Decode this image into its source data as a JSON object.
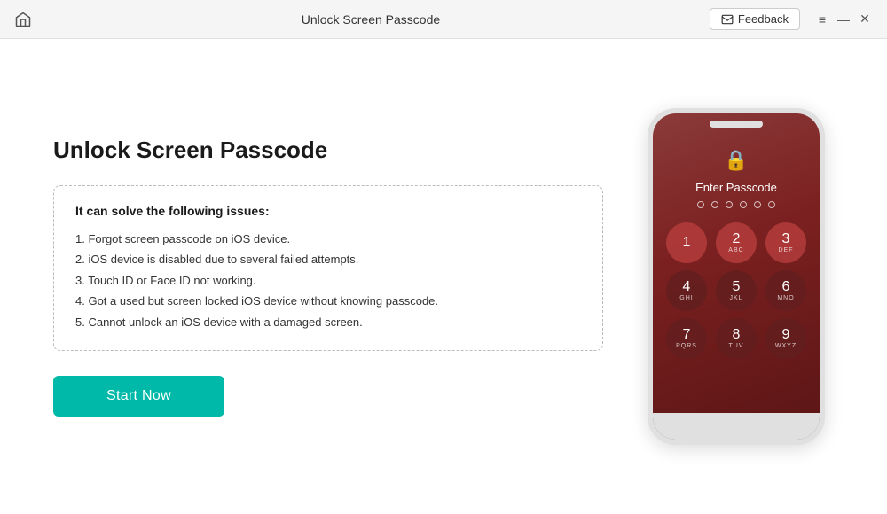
{
  "titlebar": {
    "title": "Unlock Screen Passcode",
    "feedback_label": "Feedback",
    "minimize_icon": "—",
    "close_icon": "✕",
    "menu_icon": "≡"
  },
  "main": {
    "page_title": "Unlock Screen Passcode",
    "issues_heading": "It can solve the following issues:",
    "issues": [
      "1. Forgot screen passcode on iOS device.",
      "2. iOS device is disabled due to several failed attempts.",
      "3. Touch ID or Face ID not working.",
      "4. Got a used but screen locked iOS device without knowing passcode.",
      "5. Cannot unlock an iOS device with a damaged screen."
    ],
    "start_button_label": "Start Now"
  },
  "phone": {
    "enter_passcode_text": "Enter Passcode",
    "numpad": [
      {
        "main": "1",
        "sub": ""
      },
      {
        "main": "2",
        "sub": "ABC"
      },
      {
        "main": "3",
        "sub": "DEF"
      },
      {
        "main": "4",
        "sub": "GHI"
      },
      {
        "main": "5",
        "sub": "JKL"
      },
      {
        "main": "6",
        "sub": "MNO"
      },
      {
        "main": "7",
        "sub": "PQRS"
      },
      {
        "main": "8",
        "sub": "TUV"
      },
      {
        "main": "9",
        "sub": "WXYZ"
      }
    ],
    "dots_count": 6
  }
}
